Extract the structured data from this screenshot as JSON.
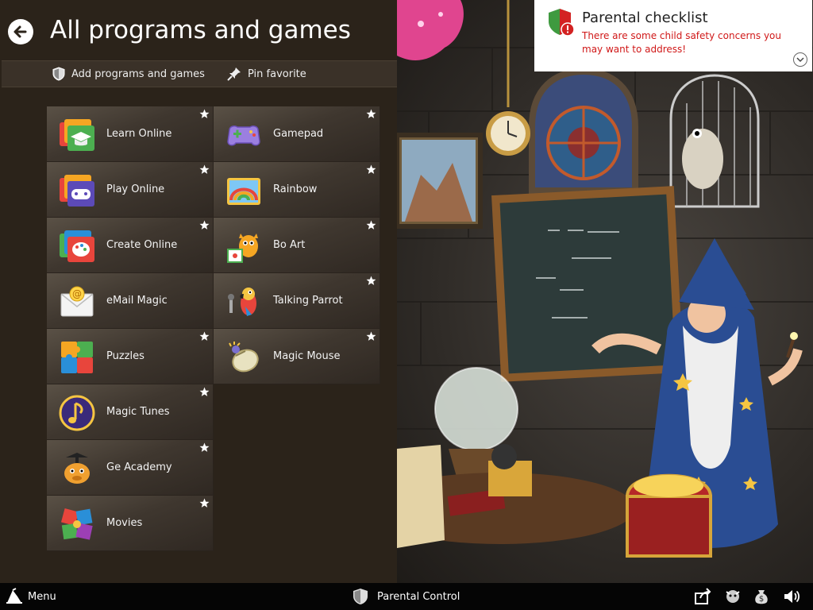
{
  "header": {
    "title": "All programs and games",
    "back_icon": "back-arrow-icon"
  },
  "toolbar": {
    "add_label": "Add programs and games",
    "add_icon": "shield-icon",
    "pin_label": "Pin favorite",
    "pin_icon": "pushpin-icon"
  },
  "tiles_left": [
    {
      "label": "Learn Online",
      "icon": "graduation-cap-icon"
    },
    {
      "label": "Play Online",
      "icon": "gamepad-folder-icon"
    },
    {
      "label": "Create Online",
      "icon": "palette-folder-icon"
    },
    {
      "label": "eMail Magic",
      "icon": "email-envelope-icon"
    },
    {
      "label": "Puzzles",
      "icon": "puzzle-icon"
    },
    {
      "label": "Magic Tunes",
      "icon": "music-note-icon"
    },
    {
      "label": "Ge Academy",
      "icon": "giraffe-icon"
    },
    {
      "label": "Movies",
      "icon": "film-icon"
    }
  ],
  "tiles_right": [
    {
      "label": "Gamepad",
      "icon": "gamepad-icon"
    },
    {
      "label": "Rainbow",
      "icon": "rainbow-icon"
    },
    {
      "label": "Bo Art",
      "icon": "cat-painter-icon"
    },
    {
      "label": "Talking Parrot",
      "icon": "parrot-icon"
    },
    {
      "label": "Magic Mouse",
      "icon": "mouse-icon"
    }
  ],
  "notification": {
    "title": "Parental checklist",
    "text": "There are some child safety concerns you may want to address!",
    "icon": "shield-warning-icon",
    "expand_icon": "chevron-down-icon"
  },
  "taskbar": {
    "menu_label": "Menu",
    "menu_icon": "wizard-hat-icon",
    "parental_label": "Parental Control",
    "parental_icon": "shield-icon",
    "tray_icons": [
      "share-icon",
      "character-icon",
      "money-bag-icon",
      "speaker-icon"
    ]
  },
  "colors": {
    "panel_bg": "#2b231a",
    "tile_bg": "#4a4238",
    "warning_red": "#d01818",
    "taskbar_bg": "#050505"
  }
}
